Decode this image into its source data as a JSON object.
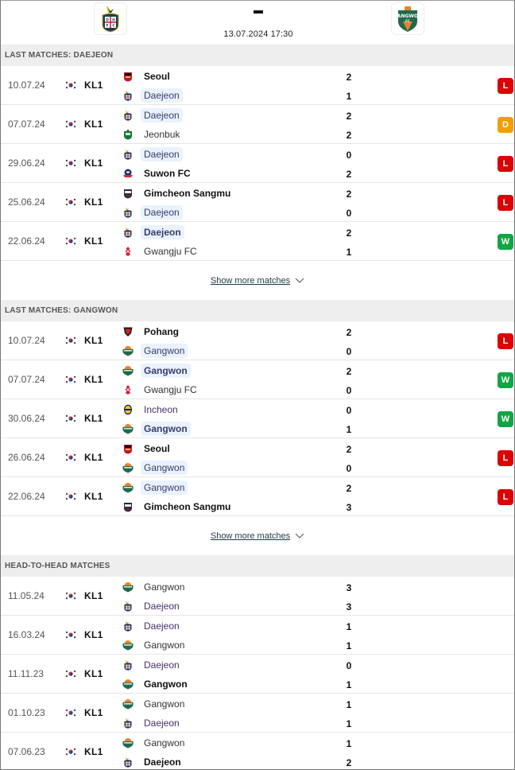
{
  "header": {
    "home_team_logo": "daejeon-logo",
    "away_team_logo": "gangwon-logo",
    "score_separator": "-",
    "kickoff": "13.07.2024 17:30"
  },
  "colors": {
    "loss": "#dd0000",
    "draw": "#f0a000",
    "win": "#11a544",
    "section_bg": "#eeeeee",
    "highlight_bg": "#e9f2fd"
  },
  "sections": [
    {
      "title": "LAST MATCHES: DAEJEON",
      "show_more": "Show more matches",
      "matches": [
        {
          "date": "10.07.24",
          "league": "KL1",
          "flag": "south-korea-flag",
          "home": {
            "name": "Seoul",
            "icon": "seoul",
            "bold": true,
            "hl": false
          },
          "home_score": "2",
          "away": {
            "name": "Daejeon",
            "icon": "daejeon",
            "bold": false,
            "hl": true
          },
          "away_score": "1",
          "result": "L"
        },
        {
          "date": "07.07.24",
          "league": "KL1",
          "flag": "south-korea-flag",
          "home": {
            "name": "Daejeon",
            "icon": "daejeon",
            "bold": false,
            "hl": true
          },
          "home_score": "2",
          "away": {
            "name": "Jeonbuk",
            "icon": "jeonbuk",
            "bold": false,
            "hl": false
          },
          "away_score": "2",
          "result": "D"
        },
        {
          "date": "29.06.24",
          "league": "KL1",
          "flag": "south-korea-flag",
          "home": {
            "name": "Daejeon",
            "icon": "daejeon",
            "bold": false,
            "hl": true
          },
          "home_score": "0",
          "away": {
            "name": "Suwon FC",
            "icon": "suwon",
            "bold": true,
            "hl": false
          },
          "away_score": "2",
          "result": "L"
        },
        {
          "date": "25.06.24",
          "league": "KL1",
          "flag": "south-korea-flag",
          "home": {
            "name": "Gimcheon Sangmu",
            "icon": "gimcheon",
            "bold": true,
            "hl": false
          },
          "home_score": "2",
          "away": {
            "name": "Daejeon",
            "icon": "daejeon",
            "bold": false,
            "hl": true
          },
          "away_score": "0",
          "result": "L"
        },
        {
          "date": "22.06.24",
          "league": "KL1",
          "flag": "south-korea-flag",
          "home": {
            "name": "Daejeon",
            "icon": "daejeon",
            "bold": true,
            "hl": true
          },
          "home_score": "2",
          "away": {
            "name": "Gwangju FC",
            "icon": "gwangju",
            "bold": false,
            "hl": false
          },
          "away_score": "1",
          "result": "W"
        }
      ]
    },
    {
      "title": "LAST MATCHES: GANGWON",
      "show_more": "Show more matches",
      "matches": [
        {
          "date": "10.07.24",
          "league": "KL1",
          "flag": "south-korea-flag",
          "home": {
            "name": "Pohang",
            "icon": "pohang",
            "bold": true,
            "hl": false
          },
          "home_score": "2",
          "away": {
            "name": "Gangwon",
            "icon": "gangwon",
            "bold": false,
            "hl": true
          },
          "away_score": "0",
          "result": "L"
        },
        {
          "date": "07.07.24",
          "league": "KL1",
          "flag": "south-korea-flag",
          "home": {
            "name": "Gangwon",
            "icon": "gangwon",
            "bold": true,
            "hl": true
          },
          "home_score": "2",
          "away": {
            "name": "Gwangju FC",
            "icon": "gwangju",
            "bold": false,
            "hl": false
          },
          "away_score": "0",
          "result": "W"
        },
        {
          "date": "30.06.24",
          "league": "KL1",
          "flag": "south-korea-flag",
          "home": {
            "name": "Incheon",
            "icon": "incheon",
            "bold": false,
            "hl": false,
            "purple": true
          },
          "home_score": "0",
          "away": {
            "name": "Gangwon",
            "icon": "gangwon",
            "bold": true,
            "hl": true
          },
          "away_score": "1",
          "result": "W"
        },
        {
          "date": "26.06.24",
          "league": "KL1",
          "flag": "south-korea-flag",
          "home": {
            "name": "Seoul",
            "icon": "seoul",
            "bold": true,
            "hl": false
          },
          "home_score": "2",
          "away": {
            "name": "Gangwon",
            "icon": "gangwon",
            "bold": false,
            "hl": true
          },
          "away_score": "0",
          "result": "L"
        },
        {
          "date": "22.06.24",
          "league": "KL1",
          "flag": "south-korea-flag",
          "home": {
            "name": "Gangwon",
            "icon": "gangwon",
            "bold": false,
            "hl": true
          },
          "home_score": "2",
          "away": {
            "name": "Gimcheon Sangmu",
            "icon": "gimcheon",
            "bold": true,
            "hl": false
          },
          "away_score": "3",
          "result": "L"
        }
      ]
    },
    {
      "title": "HEAD-TO-HEAD MATCHES",
      "show_more": null,
      "matches": [
        {
          "date": "11.05.24",
          "league": "KL1",
          "flag": "south-korea-flag",
          "home": {
            "name": "Gangwon",
            "icon": "gangwon",
            "bold": false,
            "hl": false
          },
          "home_score": "3",
          "away": {
            "name": "Daejeon",
            "icon": "daejeon",
            "bold": false,
            "hl": false,
            "purple": true
          },
          "away_score": "3",
          "result": null
        },
        {
          "date": "16.03.24",
          "league": "KL1",
          "flag": "south-korea-flag",
          "home": {
            "name": "Daejeon",
            "icon": "daejeon",
            "bold": false,
            "hl": false,
            "purple": true
          },
          "home_score": "1",
          "away": {
            "name": "Gangwon",
            "icon": "gangwon",
            "bold": false,
            "hl": false
          },
          "away_score": "1",
          "result": null
        },
        {
          "date": "11.11.23",
          "league": "KL1",
          "flag": "south-korea-flag",
          "home": {
            "name": "Daejeon",
            "icon": "daejeon",
            "bold": false,
            "hl": false,
            "purple": true
          },
          "home_score": "0",
          "away": {
            "name": "Gangwon",
            "icon": "gangwon",
            "bold": true,
            "hl": false
          },
          "away_score": "1",
          "result": null
        },
        {
          "date": "01.10.23",
          "league": "KL1",
          "flag": "south-korea-flag",
          "home": {
            "name": "Gangwon",
            "icon": "gangwon",
            "bold": false,
            "hl": false
          },
          "home_score": "1",
          "away": {
            "name": "Daejeon",
            "icon": "daejeon",
            "bold": false,
            "hl": false,
            "purple": true
          },
          "away_score": "1",
          "result": null
        },
        {
          "date": "07.06.23",
          "league": "KL1",
          "flag": "south-korea-flag",
          "home": {
            "name": "Gangwon",
            "icon": "gangwon",
            "bold": false,
            "hl": false
          },
          "home_score": "1",
          "away": {
            "name": "Daejeon",
            "icon": "daejeon",
            "bold": true,
            "hl": false
          },
          "away_score": "2",
          "result": null
        }
      ]
    }
  ]
}
